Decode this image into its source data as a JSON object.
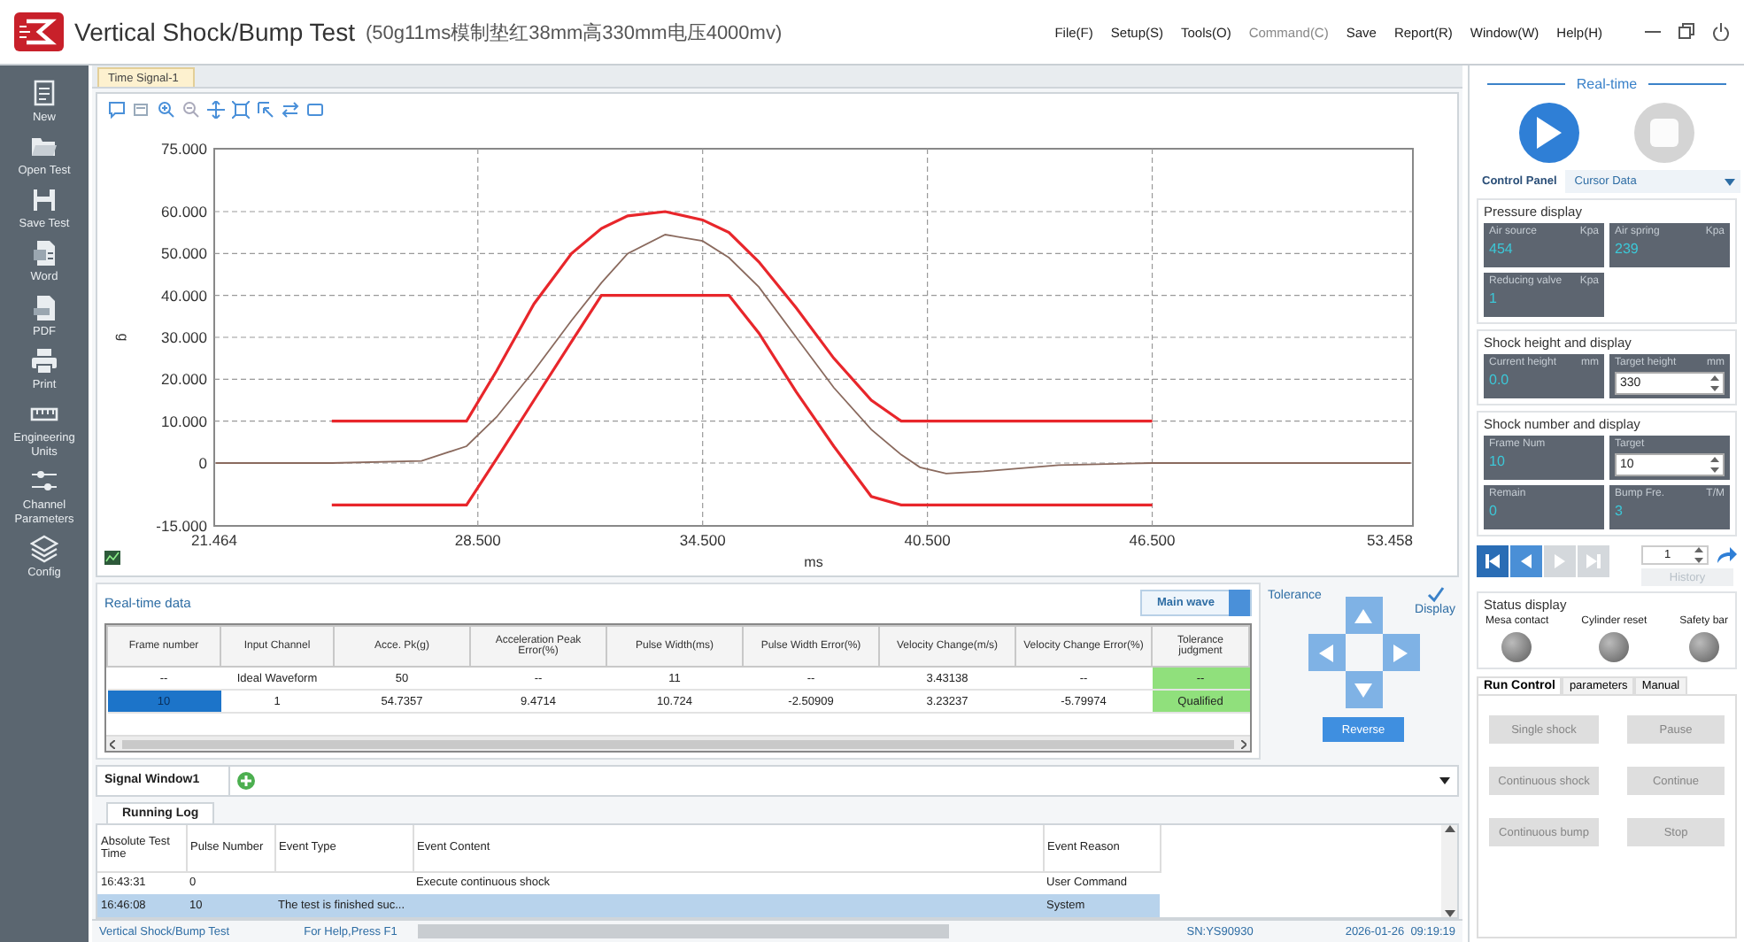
{
  "window": {
    "title": "Vertical Shock/Bump Test",
    "subtitle": "(50g11ms模制垫红38mm高330mm电压4000mv)"
  },
  "menu": [
    {
      "label": "File(F)",
      "disabled": false
    },
    {
      "label": "Setup(S)",
      "disabled": false
    },
    {
      "label": "Tools(O)",
      "disabled": false
    },
    {
      "label": "Command(C)",
      "disabled": true
    },
    {
      "label": "Save",
      "disabled": false
    },
    {
      "label": "Report(R)",
      "disabled": false
    },
    {
      "label": "Window(W)",
      "disabled": false
    },
    {
      "label": "Help(H)",
      "disabled": false
    }
  ],
  "sidebar": {
    "items": [
      {
        "label": "New",
        "kind": "new"
      },
      {
        "label": "Open Test",
        "kind": "open"
      },
      {
        "label": "Save Test",
        "kind": "save"
      },
      {
        "label": "Word",
        "kind": "word"
      },
      {
        "label": "PDF",
        "kind": "pdf"
      },
      {
        "label": "Print",
        "kind": "print"
      },
      {
        "label": "Engineering Units",
        "kind": "units"
      },
      {
        "label": "Channel Parameters",
        "kind": "channel"
      },
      {
        "label": "Config",
        "kind": "config"
      }
    ]
  },
  "document_tab": {
    "label": "Time Signal-1"
  },
  "chart": {
    "chart_data": {
      "type": "line",
      "grid": true,
      "xlabel": "ms",
      "ylabel": "g",
      "x": [
        21.5,
        24.6,
        27,
        28.2,
        29,
        30,
        31,
        31.8,
        32.5,
        33.5,
        34.5,
        35.2,
        36,
        37,
        38,
        39,
        39.8,
        40.3,
        41,
        42,
        44,
        46.5,
        53.4
      ],
      "series": [
        {
          "color": "#e8262b",
          "values": [
            null,
            10,
            10,
            10,
            22,
            38,
            50,
            56,
            59,
            60,
            58,
            55,
            48,
            37,
            25,
            15,
            10,
            10,
            10,
            10,
            10,
            10,
            null
          ]
        },
        {
          "color": "#e8262b",
          "values": [
            null,
            -10,
            -10,
            -10,
            1,
            15,
            29,
            40,
            40,
            40,
            40,
            40,
            31,
            17,
            4,
            -8,
            -10,
            -10,
            -10,
            -10,
            -10,
            -10,
            null
          ]
        },
        {
          "color": "#8a6a5e",
          "values": [
            0,
            0,
            0.5,
            4,
            11,
            22,
            34,
            43,
            50,
            54.5,
            53,
            49,
            42,
            30,
            18,
            8,
            2,
            -1,
            -2.5,
            -2,
            -0.5,
            0,
            0
          ]
        }
      ],
      "xlim": [
        21.464,
        53.458
      ],
      "ylim": [
        -15,
        75
      ],
      "xticks": [
        {
          "value": 21.464,
          "label": "21.464"
        },
        {
          "value": 28.5,
          "label": "28.500"
        },
        {
          "value": 34.5,
          "label": "34.500"
        },
        {
          "value": 40.5,
          "label": "40.500"
        },
        {
          "value": 46.5,
          "label": "46.500"
        },
        {
          "value": 53.458,
          "label": "53.458"
        }
      ],
      "yticks": [
        {
          "value": -15,
          "label": "-15.000"
        },
        {
          "value": 0,
          "label": "0"
        },
        {
          "value": 10,
          "label": "10.000"
        },
        {
          "value": 20,
          "label": "20.000"
        },
        {
          "value": 30,
          "label": "30.000"
        },
        {
          "value": 40,
          "label": "40.000"
        },
        {
          "value": 50,
          "label": "50.000"
        },
        {
          "value": 60,
          "label": "60.000"
        },
        {
          "value": 75,
          "label": "75.000"
        }
      ]
    }
  },
  "realtime_data": {
    "title": "Real-time data",
    "main_wave": {
      "label": "Main wave",
      "on": true
    },
    "columns": [
      "Frame number",
      "Input Channel",
      "Acce. Pk(g)",
      "Acceleration Peak Error(%)",
      "Pulse Width(ms)",
      "Pulse Width Error(%)",
      "Velocity Change(m/s)",
      "Velocity Change Error(%)",
      "Tolerance judgment"
    ],
    "rows": [
      {
        "selected": false,
        "cells": [
          "--",
          "Ideal Waveform",
          "50",
          "--",
          "11",
          "--",
          "3.43138",
          "--",
          "--"
        ]
      },
      {
        "selected": true,
        "cells": [
          "10",
          "1",
          "54.7357",
          "9.4714",
          "10.724",
          "-2.50909",
          "3.23237",
          "-5.79974",
          "Qualified"
        ]
      }
    ]
  },
  "tolerance": {
    "label": "Tolerance",
    "display": {
      "label": "Display",
      "checked": true
    },
    "reverse": "Reverse"
  },
  "signal_window": {
    "label": "Signal Window1"
  },
  "running_log": {
    "tab": "Running Log",
    "columns": [
      "Absolute Test Time",
      "Pulse Number",
      "Event Type",
      "Event Content",
      "Event Reason"
    ],
    "rows": [
      {
        "selected": false,
        "cells": [
          "16:43:31",
          "0",
          null,
          "Execute continuous shock",
          "User Command"
        ]
      },
      {
        "selected": true,
        "cells": [
          "16:46:08",
          "10",
          "The test is finished suc...",
          null,
          "System"
        ]
      }
    ]
  },
  "status_bar": {
    "app": "Vertical Shock/Bump Test",
    "help": "For Help,Press F1",
    "progress": {
      "level": 1
    },
    "serial": "SN:YS90930",
    "datetime": "2026-01-26  09:19:19"
  },
  "right_panel": {
    "header": "Real-time",
    "transport": [
      {
        "kind": "play",
        "disabled": false
      },
      {
        "kind": "stop",
        "disabled": true
      }
    ],
    "tabs": [
      {
        "label": "Control Panel",
        "selected": true
      },
      {
        "label": "Cursor Data",
        "selected": false
      }
    ],
    "groups": [
      {
        "title": "Pressure display",
        "tiles": [
          {
            "kind": "readout",
            "label": "Air source",
            "unit": "Kpa",
            "value": "454"
          },
          {
            "kind": "readout",
            "label": "Air spring",
            "unit": "Kpa",
            "value": "239"
          },
          {
            "kind": "readout",
            "label": "Reducing valve",
            "unit": "Kpa",
            "value": "1"
          }
        ]
      },
      {
        "title": "Shock height and display",
        "tiles": [
          {
            "kind": "readout",
            "label": "Current height",
            "unit": "mm",
            "value": "0.0"
          },
          {
            "kind": "input",
            "label": "Target height",
            "unit": "mm",
            "value": "330"
          }
        ]
      },
      {
        "title": "Shock number and display",
        "tiles": [
          {
            "kind": "readout",
            "label": "Frame Num",
            "value": "10"
          },
          {
            "kind": "input",
            "label": "Target",
            "value": "10"
          },
          {
            "kind": "readout",
            "label": "Remain",
            "value": "0"
          },
          {
            "kind": "readout",
            "label": "Bump Fre.",
            "unit": "T/M",
            "value": "3"
          }
        ]
      }
    ],
    "navigation": {
      "buttons": [
        {
          "kind": "first",
          "disabled": false
        },
        {
          "kind": "prev",
          "disabled": false
        },
        {
          "kind": "next",
          "disabled": true
        },
        {
          "kind": "last",
          "disabled": true
        }
      ],
      "frame": "1",
      "history": {
        "label": "History",
        "disabled": true
      }
    },
    "status_display": {
      "title": "Status display",
      "indicators": [
        {
          "label": "Mesa contact",
          "on": false
        },
        {
          "label": "Cylinder reset",
          "on": false
        },
        {
          "label": "Safety bar",
          "on": false
        }
      ]
    },
    "run_tabs": [
      {
        "label": "Run Control",
        "selected": true
      },
      {
        "label": "parameters",
        "selected": false
      },
      {
        "label": "Manual",
        "selected": false
      }
    ],
    "run_buttons": [
      {
        "label": "Single shock",
        "disabled": true
      },
      {
        "label": "Pause",
        "disabled": true
      },
      {
        "label": "Continuous shock",
        "disabled": true
      },
      {
        "label": "Continue",
        "disabled": true
      },
      {
        "label": "Continuous bump",
        "disabled": true
      },
      {
        "label": "Stop",
        "disabled": true
      }
    ]
  }
}
